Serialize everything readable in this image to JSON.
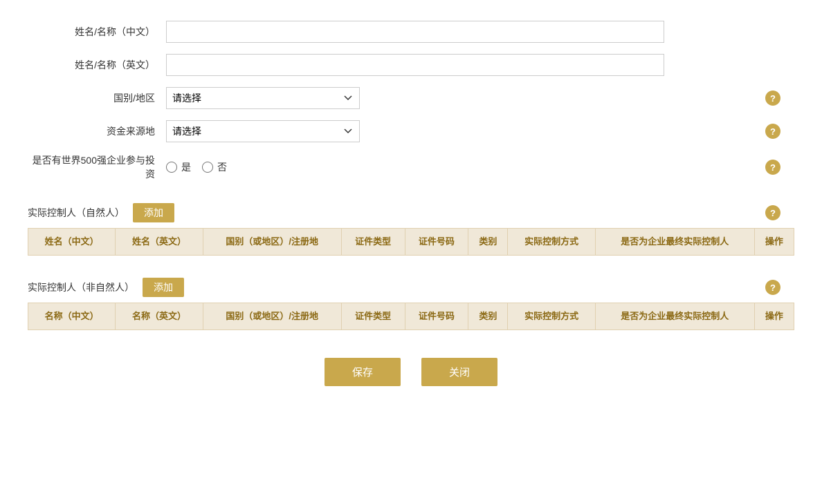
{
  "form": {
    "name_cn_label": "姓名/名称（中文）",
    "name_en_label": "姓名/名称（英文）",
    "country_label": "国别/地区",
    "fund_source_label": "资金来源地",
    "fortune500_label": "是否有世界500强企业参与投资",
    "country_placeholder": "请选择",
    "fund_source_placeholder": "请选择",
    "yes_label": "是",
    "no_label": "否",
    "name_cn_value": "",
    "name_en_value": ""
  },
  "section1": {
    "title": "实际控制人（自然人）",
    "add_label": "添加",
    "columns": [
      "姓名（中文）",
      "姓名（英文）",
      "国别（或地区）/注册地",
      "证件类型",
      "证件号码",
      "类别",
      "实际控制方式",
      "是否为企业最终实际控制人",
      "操作"
    ]
  },
  "section2": {
    "title": "实际控制人（非自然人）",
    "add_label": "添加",
    "columns": [
      "名称（中文）",
      "名称（英文）",
      "国别（或地区）/注册地",
      "证件类型",
      "证件号码",
      "类别",
      "实际控制方式",
      "是否为企业最终实际控制人",
      "操作"
    ]
  },
  "buttons": {
    "save": "保存",
    "close": "关闭"
  },
  "help_icon_text": "?"
}
